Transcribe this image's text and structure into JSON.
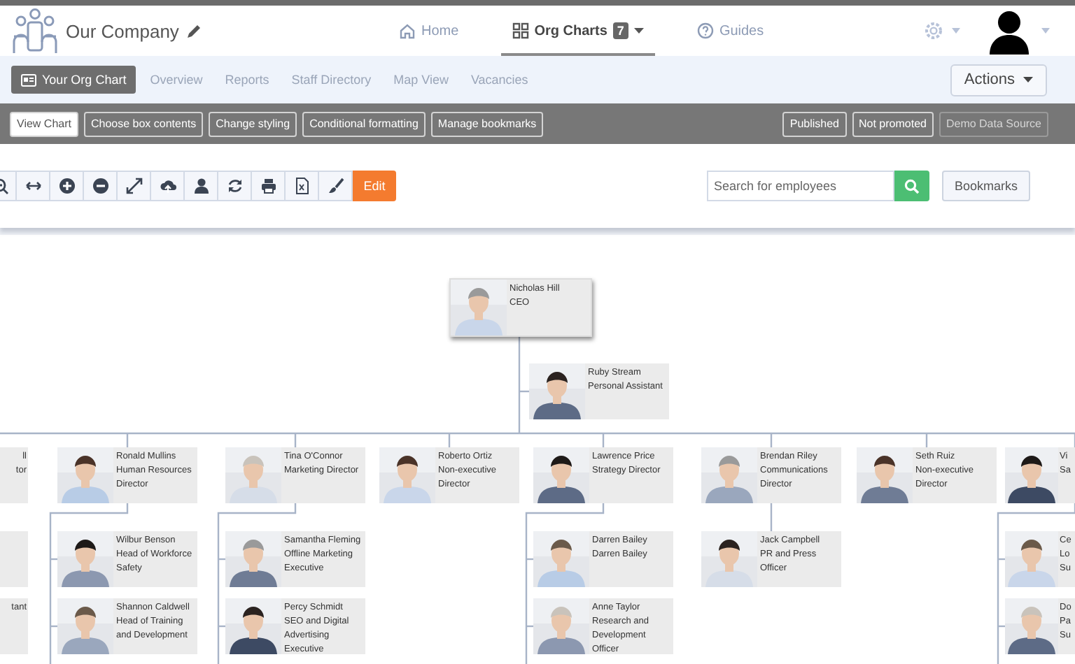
{
  "header": {
    "company": "Our Company",
    "nav": [
      {
        "kind": "home",
        "label": "Home",
        "selected": false
      },
      {
        "kind": "grid",
        "label": "Org Charts",
        "badge": "7",
        "has_menu": true,
        "selected": true
      },
      {
        "kind": "help",
        "label": "Guides",
        "selected": false
      }
    ]
  },
  "subnav": {
    "tabs": [
      {
        "label": "Your Org Chart",
        "icon": true,
        "selected": true
      },
      {
        "label": "Overview",
        "selected": false
      },
      {
        "label": "Reports",
        "selected": false
      },
      {
        "label": "Staff Directory",
        "selected": false
      },
      {
        "label": "Map View",
        "selected": false
      },
      {
        "label": "Vacancies",
        "selected": false
      }
    ],
    "actions": "Actions"
  },
  "chart_toolbar": {
    "left": [
      {
        "label": "View Chart",
        "selected": true
      },
      {
        "label": "Choose box contents",
        "selected": false
      },
      {
        "label": "Change styling",
        "selected": false
      },
      {
        "label": "Conditional formatting",
        "selected": false
      },
      {
        "label": "Manage bookmarks",
        "selected": false
      }
    ],
    "right": [
      {
        "label": "Published",
        "disabled": false
      },
      {
        "label": "Not promoted",
        "disabled": false
      },
      {
        "label": "Demo Data Source",
        "disabled": true
      }
    ]
  },
  "tools": {
    "edit": "Edit",
    "search": {
      "placeholder": "Search for employees"
    },
    "bookmarks": "Bookmarks"
  },
  "org_chart": {
    "root": {
      "kind": "person",
      "lines": [
        "Nicholas Hill",
        "CEO"
      ],
      "children": [
        {
          "kind": "assistant",
          "lines": [
            "Ruby Stream",
            "Personal Assistant"
          ]
        },
        {
          "kind": "person",
          "lines": [
            "ll",
            "tor"
          ],
          "children": [
            {
              "kind": "person"
            },
            {
              "kind": "person",
              "lines": [
                "tant"
              ]
            }
          ]
        },
        {
          "kind": "person",
          "lines": [
            "Ronald Mullins",
            "Human Resources",
            "Director"
          ],
          "children": [
            {
              "kind": "person",
              "lines": [
                "Wilbur Benson",
                "Head of Workforce",
                "Safety"
              ]
            },
            {
              "kind": "person",
              "lines": [
                "Shannon Caldwell",
                "Head of Training",
                "and Development"
              ]
            }
          ]
        },
        {
          "kind": "person",
          "lines": [
            "Tina O'Connor",
            "Marketing Director"
          ],
          "children": [
            {
              "kind": "person",
              "lines": [
                "Samantha Fleming",
                "Offline Marketing",
                "Executive"
              ]
            },
            {
              "kind": "person",
              "lines": [
                "Percy Schmidt",
                "SEO and Digital",
                "Advertising",
                "Executive"
              ]
            }
          ]
        },
        {
          "kind": "person",
          "lines": [
            "Roberto Ortiz",
            "Non-executive",
            "Director"
          ]
        },
        {
          "kind": "person",
          "lines": [
            "Lawrence Price",
            "Strategy Director"
          ],
          "children": [
            {
              "kind": "person",
              "lines": [
                "Darren Bailey",
                "Darren Bailey"
              ]
            },
            {
              "kind": "person",
              "lines": [
                "Anne Taylor",
                "Research and",
                "Development",
                "Officer"
              ]
            }
          ]
        },
        {
          "kind": "person",
          "lines": [
            "Brendan Riley",
            "Communications",
            "Director"
          ],
          "children": [
            {
              "kind": "person",
              "lines": [
                "Jack Campbell",
                "PR and Press",
                "Officer"
              ]
            }
          ]
        },
        {
          "kind": "person",
          "lines": [
            "Seth Ruiz",
            "Non-executive",
            "Director"
          ]
        },
        {
          "kind": "person",
          "lines": [
            "Vi",
            "Sa"
          ],
          "children": [
            {
              "kind": "person",
              "lines": [
                "Ce",
                "Lo",
                "Su"
              ]
            },
            {
              "kind": "person",
              "lines": [
                "Do",
                "Pa",
                "Su"
              ]
            }
          ]
        }
      ]
    }
  }
}
